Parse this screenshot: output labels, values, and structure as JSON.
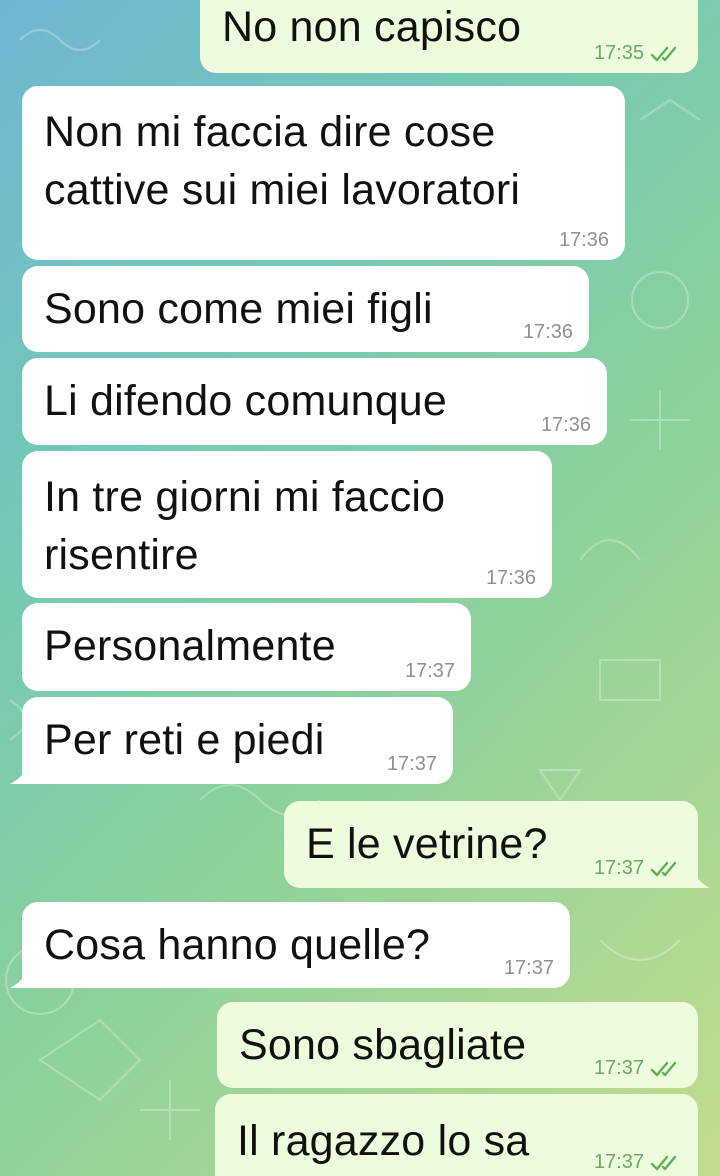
{
  "chat": {
    "messages": [
      {
        "direction": "out",
        "text": "No non capisco",
        "time": "17:35",
        "read": true
      },
      {
        "direction": "in",
        "text": "Non mi faccia dire cose\ncattive sui miei lavoratori",
        "time": "17:36"
      },
      {
        "direction": "in",
        "text": "Sono come miei figli",
        "time": "17:36"
      },
      {
        "direction": "in",
        "text": "Li difendo comunque",
        "time": "17:36"
      },
      {
        "direction": "in",
        "text": "In tre giorni mi faccio\nrisentire",
        "time": "17:36"
      },
      {
        "direction": "in",
        "text": "Personalmente",
        "time": "17:37"
      },
      {
        "direction": "in",
        "text": "Per reti e piedi",
        "time": "17:37"
      },
      {
        "direction": "out",
        "text": "E le vetrine?",
        "time": "17:37",
        "read": true
      },
      {
        "direction": "in",
        "text": "Cosa hanno quelle?",
        "time": "17:37"
      },
      {
        "direction": "out",
        "text": "Sono sbagliate",
        "time": "17:37",
        "read": true
      },
      {
        "direction": "out",
        "text": "Il ragazzo lo sa",
        "time": "17:37",
        "read": true
      }
    ]
  },
  "colors": {
    "incoming_bubble": "#ffffff",
    "outgoing_bubble": "#eefcde",
    "read_check": "#5fb05a"
  },
  "icons": {
    "read_receipt": "double-check-icon"
  }
}
